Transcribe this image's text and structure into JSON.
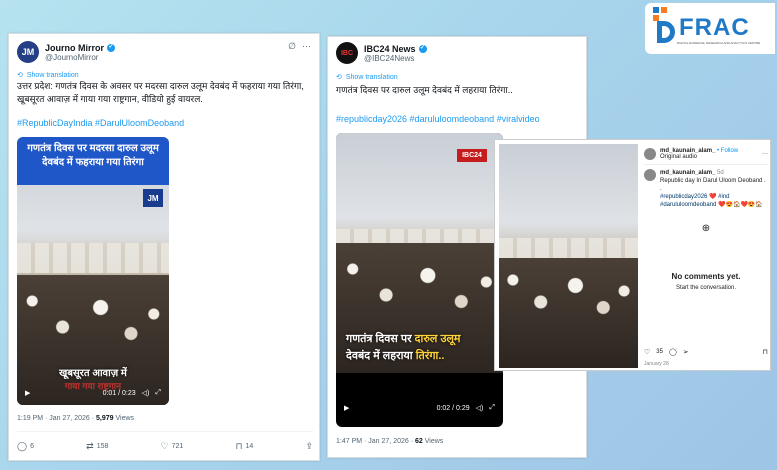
{
  "tweet1": {
    "author": "Journo Mirror",
    "handle": "@JournoMirror",
    "avatar_text": "JM",
    "show_translation": "Show translation",
    "text": "उत्तर प्रदेश: गणतंत्र दिवस के अवसर पर मदरसा दारुल उलूम देवबंद में फहराया गया तिरंगा, खूबसूरत आवाज़ में गाया गया राष्ट्रगान, वीडियो हुई वायरल.",
    "hashtags": "#RepublicDayIndia #DarulUloomDeoband",
    "video_banner": "गणतंत्र दिवस पर मदरसा दारुल उलूम देवबंद में फहराया गया तिरंगा",
    "video_badge": "JM",
    "video_caption": "खूबसूरत आवाज़ में",
    "video_caption2": "गाया गया राष्ट्रगान",
    "video_time": "0:01 / 0:23",
    "timestamp": "1:19 PM · Jan 27, 2026 · ",
    "views_count": "5,979",
    "views_label": " Views",
    "replies": "6",
    "reposts": "158",
    "likes": "721",
    "bookmarks": "14"
  },
  "tweet2": {
    "author": "IBC24 News",
    "handle": "@IBC24News",
    "avatar_text": "IBC",
    "show_translation": "Show translation",
    "text": "गणतंत्र दिवस पर दारुल उलूम देवबंद में लहराया तिरंगा..",
    "hashtags": "#republicday2026 #darululoomdeoband #viralvideo",
    "video_badge": "IBC24",
    "video_caption_a": "गणतंत्र दिवस पर ",
    "video_caption_b": "दारुल उलूम",
    "video_caption_c": "देवबंद में लहराया ",
    "video_caption_d": "तिरंगा..",
    "video_time": "0:02 / 0:29",
    "timestamp": "1:47 PM · Jan 27, 2026 · ",
    "views_count": "62",
    "views_label": " Views"
  },
  "instagram": {
    "user": "md_kaunain_alam_",
    "follow": "• Follow",
    "audio": "Original audio",
    "comment_user": "md_kaunain_alam_",
    "comment_age": "5d",
    "comment_text": "Republic day In Darul Uloom Deoband . .",
    "comment_tags": "#republicday2026 ❤️ #ind #darululoomdeoband ❤️😍🏠❤️😍🏠",
    "no_comments": "No comments yet.",
    "start": "Start the conversation.",
    "likes": "35",
    "date": "January 28"
  },
  "logo": {
    "text": "FRAC",
    "tagline": "DIGITAL EVIDENCE, RESEARCH AND ANALYTICS CENTRE"
  },
  "colors": {
    "twitter_blue": "#1d9bf0",
    "banner_blue": "#1f56c8",
    "caption_yellow": "#ffd23a"
  }
}
